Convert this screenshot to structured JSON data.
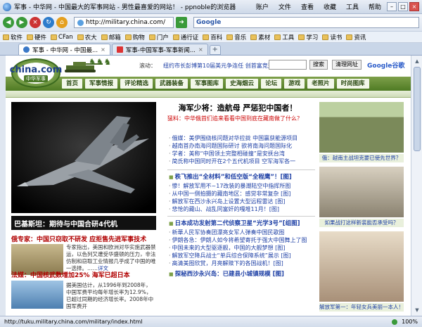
{
  "window": {
    "title": "军事 - 中华网 - 中国最大的军事网站 - 男性最喜爱的网站！ - ppnoble的浏览器",
    "menu": [
      "账户",
      "文件",
      "查看",
      "收藏",
      "工具",
      "帮助"
    ]
  },
  "address": {
    "url": "http://military.china.com/",
    "search_placeholder": "Google"
  },
  "bookmarks": [
    "软件",
    "硬件",
    "CFan",
    "农大",
    "邮箱",
    "购物",
    "门户",
    "通行证",
    "百科",
    "音乐",
    "素材",
    "工具",
    "学习",
    "读书",
    "资讯"
  ],
  "tabs": [
    {
      "label": "军事 - 中华网 - 中国最...",
      "active": true
    },
    {
      "label": "军事-中国军事-军事新闻...",
      "active": false
    }
  ],
  "site": {
    "logo_name": "china.com",
    "logo_sub": "中华军事",
    "ticker_label": "滚动：",
    "ticker_text": "纽约市长彭博第10届美元争连任 创首富竞选纪录",
    "search_button": "搜索",
    "web_button": "清理网址",
    "google": "Google谷歌",
    "nav": [
      "首页",
      "军事情报",
      "评论精选",
      "武器装备",
      "军事图库",
      "史海烟云",
      "论坛",
      "游戏",
      "老照片",
      "时尚图库"
    ]
  },
  "feature": {
    "caption": "巴基斯坦：期待与中国合研4代机"
  },
  "left": {
    "head1": "俄专家：中国只窃取不研发 应拒售先进军事技术",
    "text1": "专家指出，美国和欧洲对华实施武器禁运，以色列又遭受华盛顿的压力，非法仿制和窃取工业情报几乎成了中国的唯一选择。……",
    "text1_more": "详文",
    "head2": "法媒：中国核武数增加25% 海军已超日本",
    "text2": "据美国估计，从1996年到2008年，中国军费平均每年增长率为12.9%，已超过同期的经济增长率。2008年中国军费开"
  },
  "center": {
    "headline": "海军少将：造航母 严惩犯中国者！",
    "subhead": "猛料：中华俄首们追来看看中国到底在藏南做了什么？",
    "list1": [
      "俄媒：美伊围绕核问题对华拉拢 中国赢获能源项目",
      "越南首办南海问题国际研讨 欲将南海问题国际化",
      "学者：美称“中国领土完整相碰撞”是安抚台湾",
      "简氏称中国同时开在2个五代机项目 空军海军各一"
    ],
    "sec1": "秩飞推出“全材料”和低空版“全程鹰”！[图]",
    "list2": [
      "惨！解放军用不~17改装的暴潮陆空中指挥所图",
      "从中国一侧拍摄的藏南地区：感觉非常复杂 [图]",
      "解放军在西沙永兴岛上设置大型远程雷达 [图]",
      "悲怆的藏山、战乱同富奸的嘎堆11月！[图]"
    ],
    "sec2": "日本成功发射第二代侦察卫星“光学3号”[组图]",
    "list3": [
      "新華人民军协奏团漂亮女军人弹奏中国民歌图",
      "伊朗各急：伊朗人如今将希望寄托于强大中国舞上了图",
      "中国未来的大型驱逐舰，中国的大舰梦想 [图]",
      "解放军空降兵战士“单兵综合保障系统”展示 [图]",
      "高清美图欣赏，月亮解赎下的各国战机！[图]"
    ],
    "sec3": "探秘西沙永兴岛：已建县小城镇规模 [图]"
  },
  "right": {
    "cap1": "俄：越南主战坦克要已使先世界？",
    "cap2": "如果战打这样新装能否承受吗？",
    "cap3": "解放军第一：年轻女兵美丽一本人！"
  },
  "status": {
    "url": "http://tuku.military.china.com/military/index.html",
    "zoom": "100%"
  }
}
